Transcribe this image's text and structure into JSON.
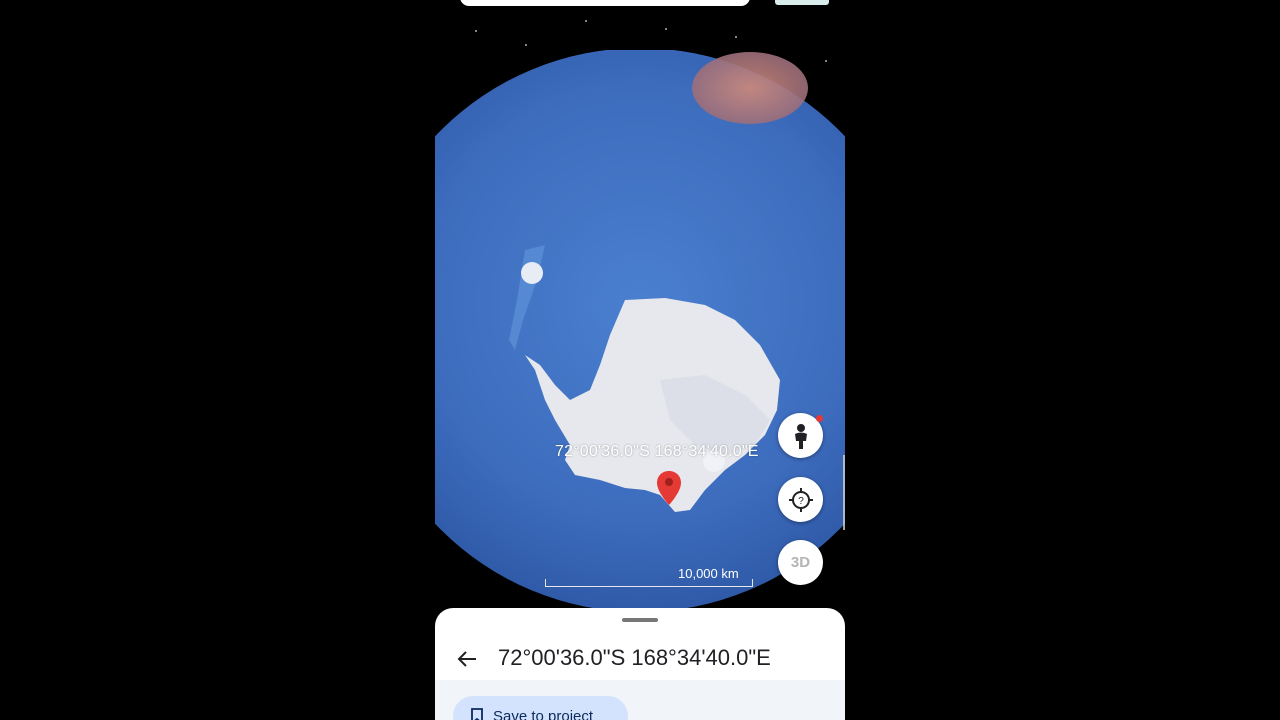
{
  "map": {
    "coordinate_label": "72°00'36.0\"S 168°34'40.0\"E",
    "scale_label": "10,000 km"
  },
  "controls": {
    "three_d_label": "3D",
    "person_icon": "pegman-icon",
    "locate_icon": "locate-icon"
  },
  "sheet": {
    "title": "72°00'36.0\"S 168°34'40.0\"E",
    "save_label": "Save to project",
    "back_icon": "back-arrow-icon",
    "save_icon": "bookmark-icon"
  },
  "colors": {
    "ocean": "#3e6fc0",
    "ice": "#e6e8ee",
    "pin": "#e53935",
    "save_button": "#d3e3fd"
  }
}
